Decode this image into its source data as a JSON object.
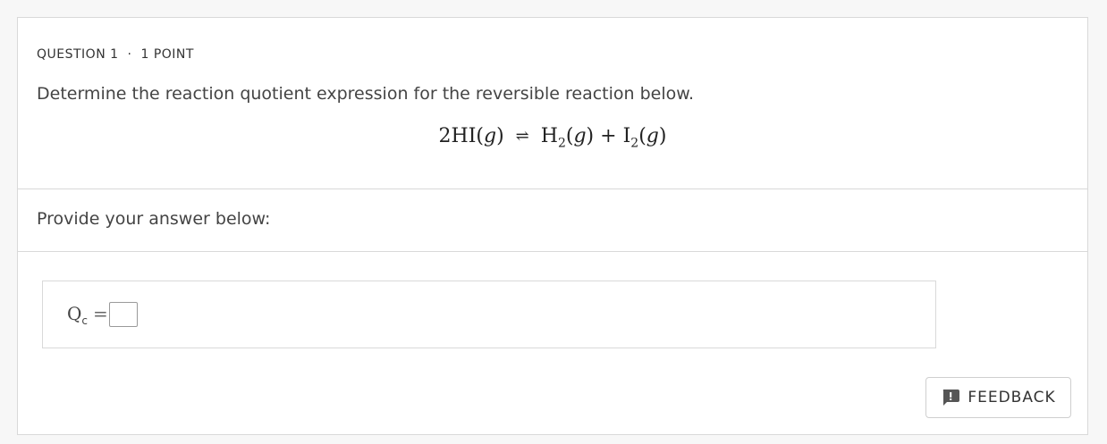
{
  "question": {
    "number_label": "QUESTION 1",
    "separator": "·",
    "points_label": "1 POINT",
    "prompt": "Determine the reaction quotient expression for the reversible reaction below.",
    "equation": {
      "reactant": "2HI",
      "reactant_state": "g",
      "arrow": "⇌",
      "product1": "H",
      "product1_sub": "2",
      "product1_state": "g",
      "plus": "+",
      "product2": "I",
      "product2_sub": "2",
      "product2_state": "g"
    }
  },
  "answer": {
    "label": "Provide your answer below:",
    "lhs": "Q",
    "lhs_sub": "c",
    "equals": "=",
    "input_value": ""
  },
  "feedback": {
    "label": "FEEDBACK",
    "icon": "feedback-bubble-icon"
  },
  "colors": {
    "background": "#f7f7f7",
    "card": "#ffffff",
    "border": "#d9d9d9",
    "text": "#333333"
  }
}
